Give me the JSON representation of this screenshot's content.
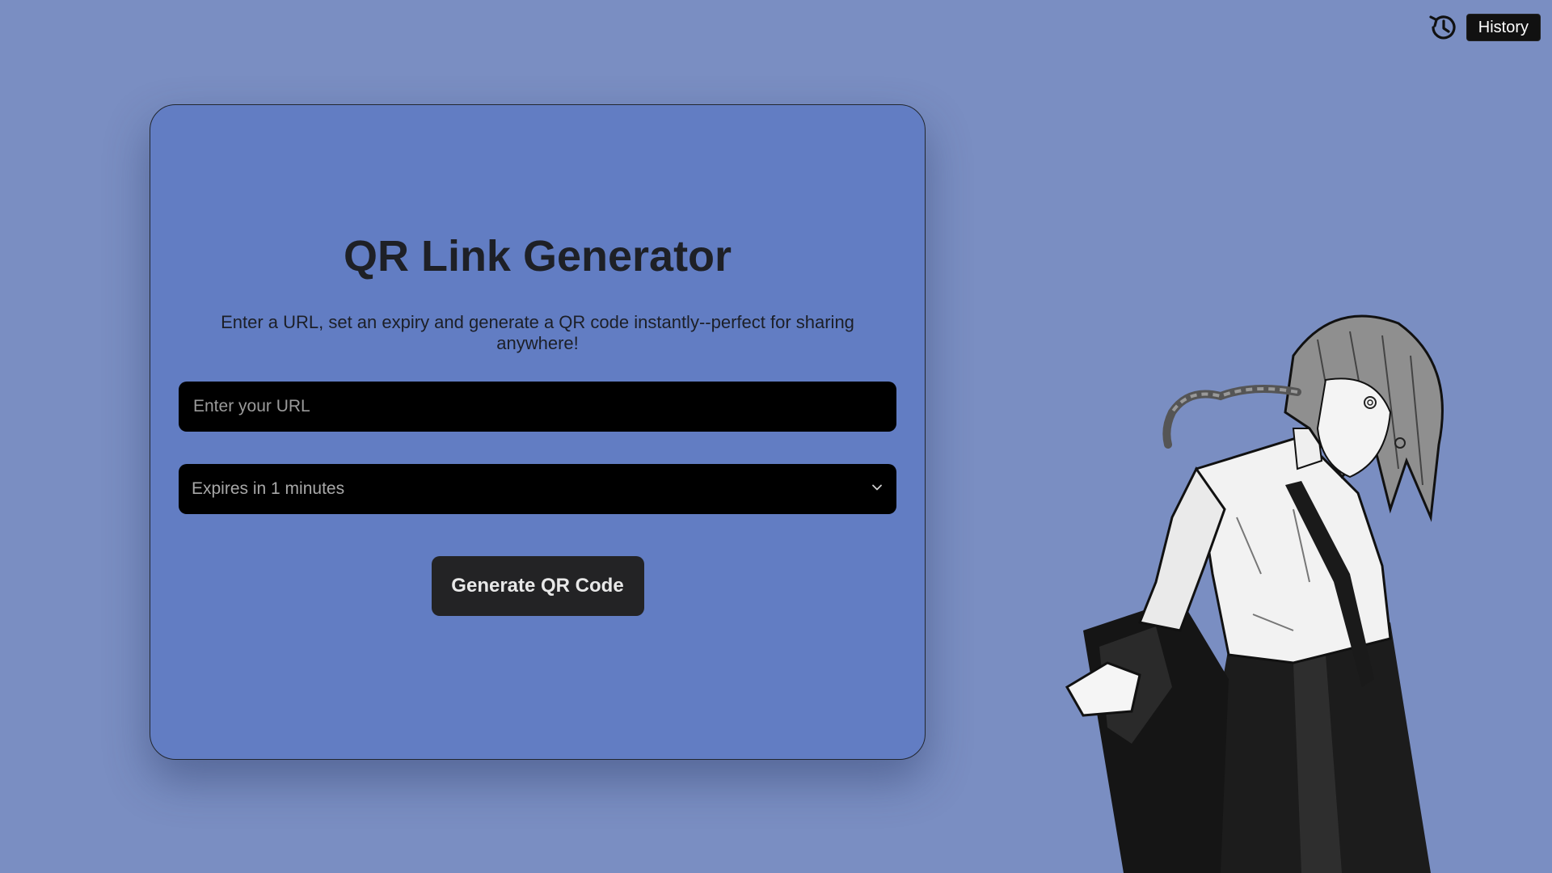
{
  "history": {
    "icon": "history-clock-icon",
    "label": "History"
  },
  "card": {
    "title": "QR Link Generator",
    "subtitle": "Enter a URL, set an expiry and generate a QR code instantly--perfect for sharing anywhere!",
    "url_input": {
      "placeholder": "Enter your URL",
      "value": ""
    },
    "expiry_select": {
      "selected": "Expires in 1 minutes"
    },
    "generate_label": "Generate QR Code"
  },
  "colors": {
    "page_background": "#7a8ec2",
    "card_background": "#627dc3",
    "field_background": "#000000",
    "button_background": "#232325"
  }
}
